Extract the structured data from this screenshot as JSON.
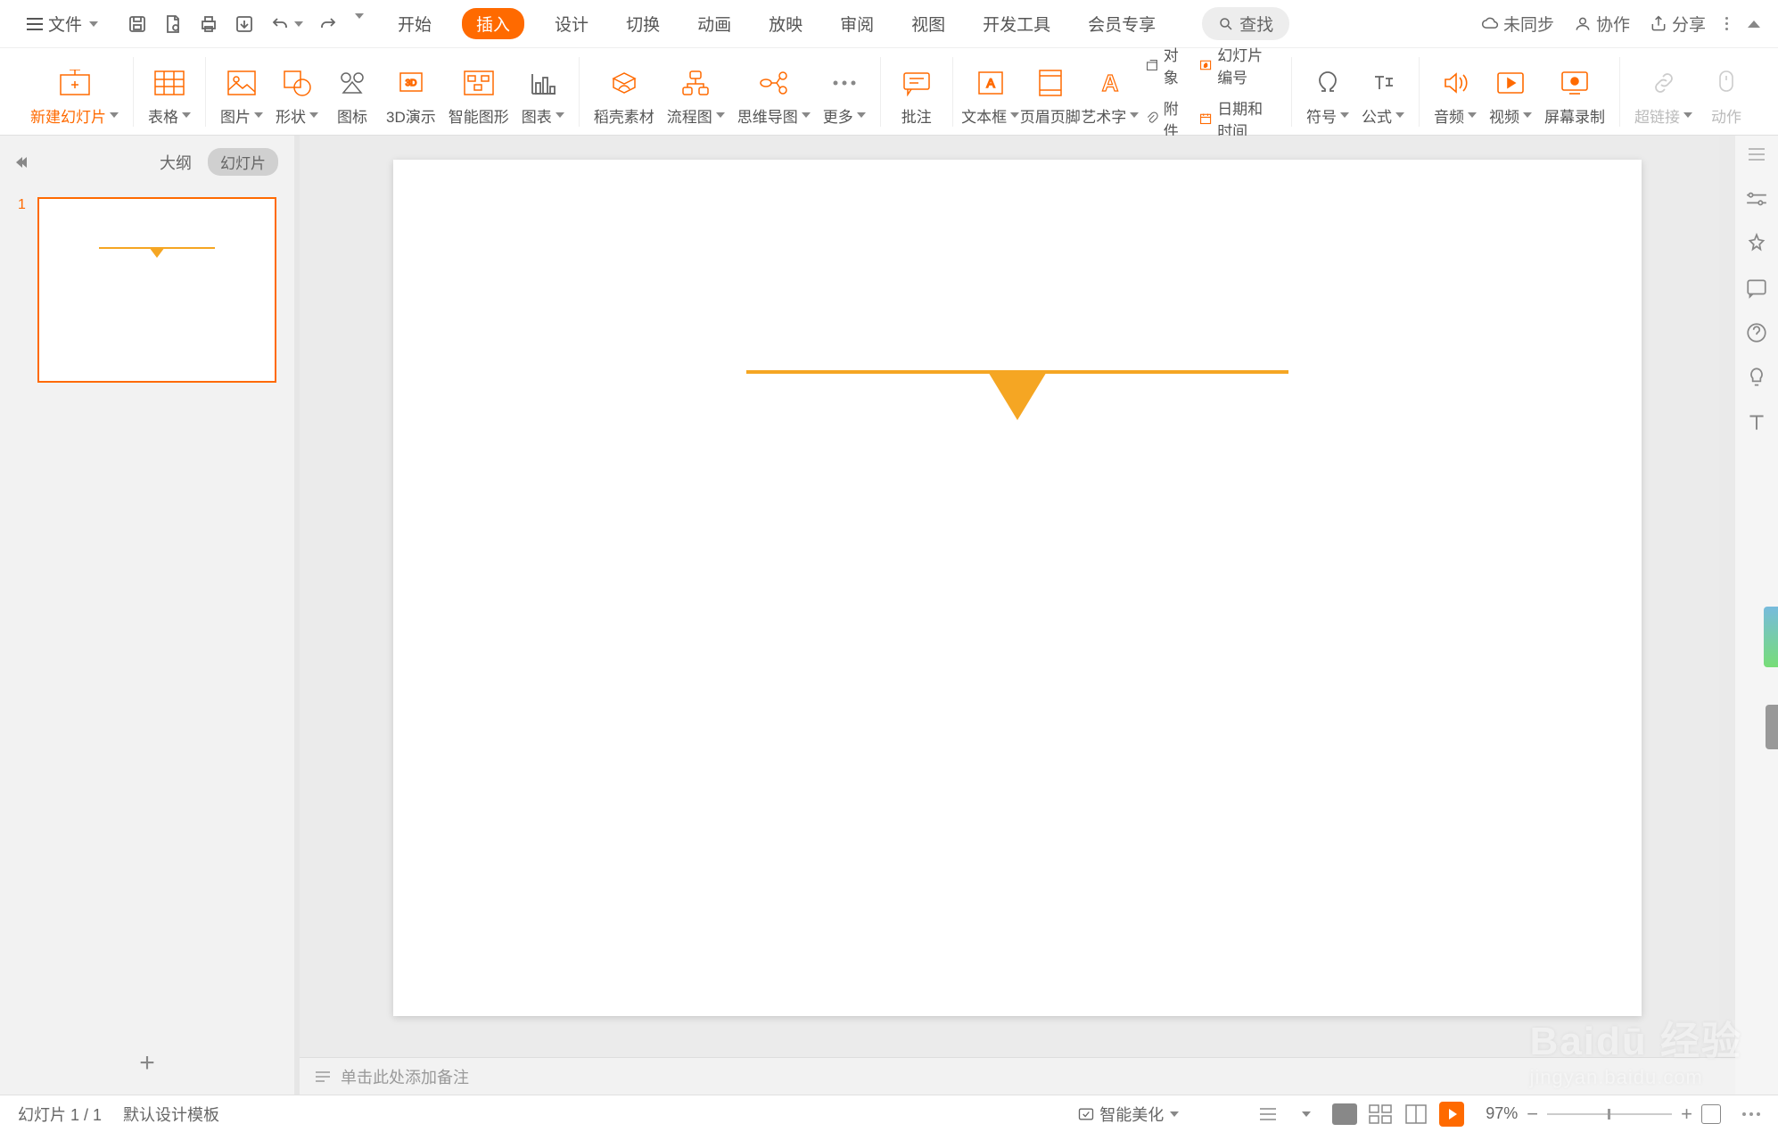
{
  "menu": {
    "file": "文件",
    "tabs": [
      "开始",
      "插入",
      "设计",
      "切换",
      "动画",
      "放映",
      "审阅",
      "视图",
      "开发工具",
      "会员专享"
    ],
    "active_tab_index": 1,
    "search": "查找",
    "sync": "未同步",
    "collab": "协作",
    "share": "分享"
  },
  "ribbon": {
    "new_slide": "新建幻灯片",
    "table": "表格",
    "image": "图片",
    "shape": "形状",
    "icon": "图标",
    "threeD": "3D演示",
    "smart": "智能图形",
    "chart": "图表",
    "doke": "稻壳素材",
    "flowchart": "流程图",
    "mindmap": "思维导图",
    "more": "更多",
    "comment": "批注",
    "textbox": "文本框",
    "header": "页眉页脚",
    "wordart": "艺术字",
    "object": "对象",
    "slidenum": "幻灯片编号",
    "attach": "附件",
    "datetime": "日期和时间",
    "symbol": "符号",
    "formula": "公式",
    "audio": "音频",
    "video": "视频",
    "screenrec": "屏幕录制",
    "hyperlink": "超链接",
    "action": "动作"
  },
  "thumbs": {
    "outline": "大纲",
    "slides_tab": "幻灯片",
    "slide1_num": "1"
  },
  "notes_placeholder": "单击此处添加备注",
  "status": {
    "slide_pos": "幻灯片 1 / 1",
    "template": "默认设计模板",
    "beautify": "智能美化",
    "zoom": "97%"
  },
  "watermark": {
    "brand": "Baidū 经验",
    "url": "jingyan.baidu.com"
  }
}
